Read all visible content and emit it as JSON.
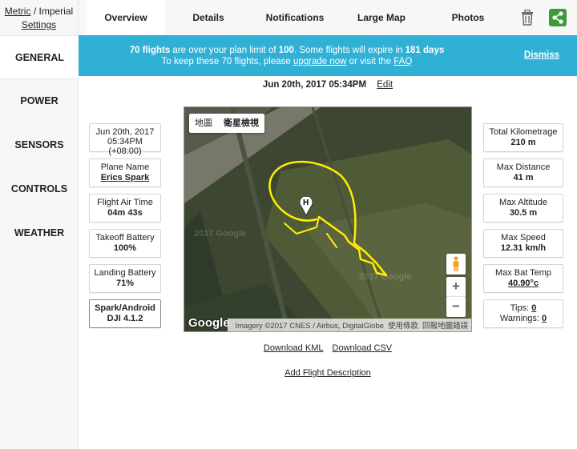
{
  "units": {
    "metric": "Metric",
    "separator": "/",
    "imperial": "Imperial",
    "settings": "Settings"
  },
  "sidebar": {
    "items": [
      {
        "label": "GENERAL"
      },
      {
        "label": "POWER"
      },
      {
        "label": "SENSORS"
      },
      {
        "label": "CONTROLS"
      },
      {
        "label": "WEATHER"
      }
    ]
  },
  "tabs": [
    {
      "label": "Overview"
    },
    {
      "label": "Details"
    },
    {
      "label": "Notifications"
    },
    {
      "label": "Large Map"
    },
    {
      "label": "Photos"
    }
  ],
  "icons": {
    "delete": "trash-icon",
    "share": "share-icon"
  },
  "colors": {
    "banner": "#31b0d5",
    "share_green": "#3a9b3a",
    "flight_path": "#ffee00"
  },
  "banner": {
    "count": "70 flights",
    "text1": " are over your plan limit of ",
    "limit": "100",
    "text2": ". Some flights will expire in ",
    "days": "181 days",
    "line2_a": "To keep these 70 flights, please ",
    "upgrade": "upgrade now",
    "line2_b": " or visit the ",
    "faq": "FAQ",
    "dismiss": "Dismiss"
  },
  "flight": {
    "datetime": "Jun 20th, 2017 05:34PM",
    "edit": "Edit"
  },
  "left_stats": {
    "start": {
      "line1": "Jun 20th, 2017",
      "line2": "05:34PM (+08:00)"
    },
    "plane": {
      "label": "Plane Name",
      "value": "Erics Spark"
    },
    "airtime": {
      "label": "Flight Air Time",
      "value": "04m 43s"
    },
    "takeoff": {
      "label": "Takeoff Battery",
      "value": "100%"
    },
    "landing": {
      "label": "Landing Battery",
      "value": "71%"
    },
    "app": {
      "line1": "Spark/Android",
      "line2": "DJI 4.1.2"
    }
  },
  "right_stats": {
    "km": {
      "label": "Total Kilometrage",
      "value": "210 m"
    },
    "dist": {
      "label": "Max Distance",
      "value": "41 m"
    },
    "alt": {
      "label": "Max Altitude",
      "value": "30.5 m"
    },
    "speed": {
      "label": "Max Speed",
      "value": "12.31 km/h"
    },
    "temp": {
      "label": "Max Bat Temp",
      "value": "40.90°c"
    },
    "tips": {
      "label": "Tips:",
      "value": "0"
    },
    "warnings": {
      "label": "Warnings:",
      "value": "0"
    }
  },
  "map": {
    "map_type": "地圖",
    "satellite_type": "衛星檢視",
    "zoom_in": "+",
    "zoom_out": "−",
    "home_marker": "H",
    "logo": "Google",
    "watermark1": "2017 Google",
    "watermark2": "2017 Google",
    "attribution": "Imagery ©2017 CNES / Airbus, DigitalGlobe",
    "terms": "使用條款",
    "report": "回報地圖錯誤"
  },
  "downloads": {
    "kml": "Download KML",
    "csv": "Download CSV"
  },
  "add_description": "Add Flight Description"
}
